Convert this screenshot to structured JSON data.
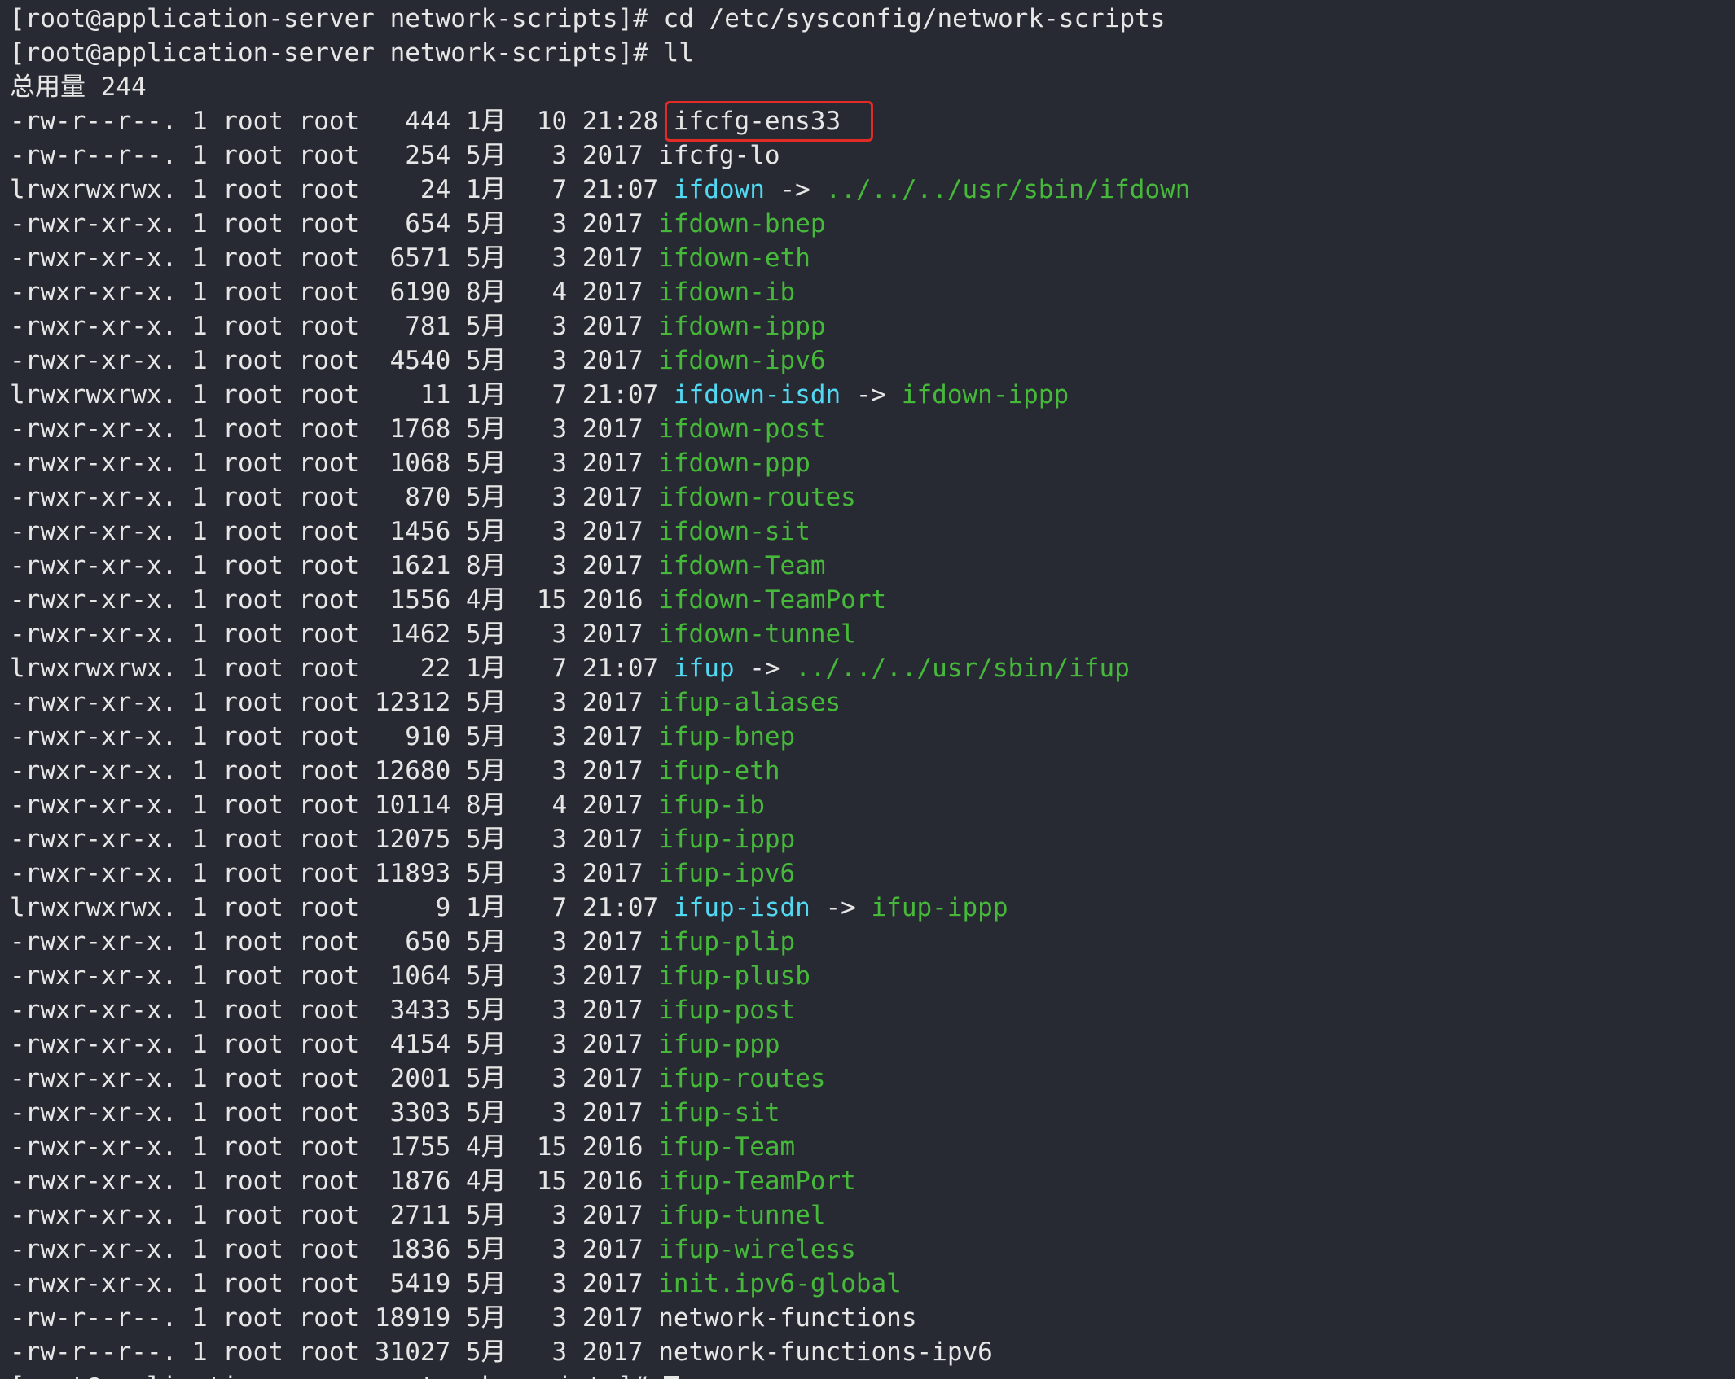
{
  "window": {
    "prompt": "[root@application-server network-scripts]# ",
    "command_cd": "cd /etc/sysconfig/network-scripts",
    "command_ll": "ll",
    "total": "总用量 244",
    "last_prompt_partial": "[root@application-server network-scripts]# ",
    "highlighted_file": "ifcfg-ens33"
  },
  "theme": {
    "background": "#282a33",
    "text": "#e6e6e6",
    "executable": "#46b83a",
    "symlink": "#51d9f2",
    "highlight_box": "#e32b25"
  },
  "listing": [
    {
      "meta": "-rw-r--r--. 1 root root   444 1月  10 21:28 ",
      "name": "ifcfg-ens33",
      "type": "regular",
      "highlight": true
    },
    {
      "meta": "-rw-r--r--. 1 root root   254 5月   3 2017 ",
      "name": "ifcfg-lo",
      "type": "regular"
    },
    {
      "meta": "lrwxrwxrwx. 1 root root    24 1月   7 21:07 ",
      "name": "ifdown",
      "type": "link",
      "target": "../../../usr/sbin/ifdown"
    },
    {
      "meta": "-rwxr-xr-x. 1 root root   654 5月   3 2017 ",
      "name": "ifdown-bnep",
      "type": "exec"
    },
    {
      "meta": "-rwxr-xr-x. 1 root root  6571 5月   3 2017 ",
      "name": "ifdown-eth",
      "type": "exec"
    },
    {
      "meta": "-rwxr-xr-x. 1 root root  6190 8月   4 2017 ",
      "name": "ifdown-ib",
      "type": "exec"
    },
    {
      "meta": "-rwxr-xr-x. 1 root root   781 5月   3 2017 ",
      "name": "ifdown-ippp",
      "type": "exec"
    },
    {
      "meta": "-rwxr-xr-x. 1 root root  4540 5月   3 2017 ",
      "name": "ifdown-ipv6",
      "type": "exec"
    },
    {
      "meta": "lrwxrwxrwx. 1 root root    11 1月   7 21:07 ",
      "name": "ifdown-isdn",
      "type": "link",
      "target": "ifdown-ippp"
    },
    {
      "meta": "-rwxr-xr-x. 1 root root  1768 5月   3 2017 ",
      "name": "ifdown-post",
      "type": "exec"
    },
    {
      "meta": "-rwxr-xr-x. 1 root root  1068 5月   3 2017 ",
      "name": "ifdown-ppp",
      "type": "exec"
    },
    {
      "meta": "-rwxr-xr-x. 1 root root   870 5月   3 2017 ",
      "name": "ifdown-routes",
      "type": "exec"
    },
    {
      "meta": "-rwxr-xr-x. 1 root root  1456 5月   3 2017 ",
      "name": "ifdown-sit",
      "type": "exec"
    },
    {
      "meta": "-rwxr-xr-x. 1 root root  1621 8月   3 2017 ",
      "name": "ifdown-Team",
      "type": "exec"
    },
    {
      "meta": "-rwxr-xr-x. 1 root root  1556 4月  15 2016 ",
      "name": "ifdown-TeamPort",
      "type": "exec"
    },
    {
      "meta": "-rwxr-xr-x. 1 root root  1462 5月   3 2017 ",
      "name": "ifdown-tunnel",
      "type": "exec"
    },
    {
      "meta": "lrwxrwxrwx. 1 root root    22 1月   7 21:07 ",
      "name": "ifup",
      "type": "link",
      "target": "../../../usr/sbin/ifup"
    },
    {
      "meta": "-rwxr-xr-x. 1 root root 12312 5月   3 2017 ",
      "name": "ifup-aliases",
      "type": "exec"
    },
    {
      "meta": "-rwxr-xr-x. 1 root root   910 5月   3 2017 ",
      "name": "ifup-bnep",
      "type": "exec"
    },
    {
      "meta": "-rwxr-xr-x. 1 root root 12680 5月   3 2017 ",
      "name": "ifup-eth",
      "type": "exec"
    },
    {
      "meta": "-rwxr-xr-x. 1 root root 10114 8月   4 2017 ",
      "name": "ifup-ib",
      "type": "exec"
    },
    {
      "meta": "-rwxr-xr-x. 1 root root 12075 5月   3 2017 ",
      "name": "ifup-ippp",
      "type": "exec"
    },
    {
      "meta": "-rwxr-xr-x. 1 root root 11893 5月   3 2017 ",
      "name": "ifup-ipv6",
      "type": "exec"
    },
    {
      "meta": "lrwxrwxrwx. 1 root root     9 1月   7 21:07 ",
      "name": "ifup-isdn",
      "type": "link",
      "target": "ifup-ippp"
    },
    {
      "meta": "-rwxr-xr-x. 1 root root   650 5月   3 2017 ",
      "name": "ifup-plip",
      "type": "exec"
    },
    {
      "meta": "-rwxr-xr-x. 1 root root  1064 5月   3 2017 ",
      "name": "ifup-plusb",
      "type": "exec"
    },
    {
      "meta": "-rwxr-xr-x. 1 root root  3433 5月   3 2017 ",
      "name": "ifup-post",
      "type": "exec"
    },
    {
      "meta": "-rwxr-xr-x. 1 root root  4154 5月   3 2017 ",
      "name": "ifup-ppp",
      "type": "exec"
    },
    {
      "meta": "-rwxr-xr-x. 1 root root  2001 5月   3 2017 ",
      "name": "ifup-routes",
      "type": "exec"
    },
    {
      "meta": "-rwxr-xr-x. 1 root root  3303 5月   3 2017 ",
      "name": "ifup-sit",
      "type": "exec"
    },
    {
      "meta": "-rwxr-xr-x. 1 root root  1755 4月  15 2016 ",
      "name": "ifup-Team",
      "type": "exec"
    },
    {
      "meta": "-rwxr-xr-x. 1 root root  1876 4月  15 2016 ",
      "name": "ifup-TeamPort",
      "type": "exec"
    },
    {
      "meta": "-rwxr-xr-x. 1 root root  2711 5月   3 2017 ",
      "name": "ifup-tunnel",
      "type": "exec"
    },
    {
      "meta": "-rwxr-xr-x. 1 root root  1836 5月   3 2017 ",
      "name": "ifup-wireless",
      "type": "exec"
    },
    {
      "meta": "-rwxr-xr-x. 1 root root  5419 5月   3 2017 ",
      "name": "init.ipv6-global",
      "type": "exec"
    },
    {
      "meta": "-rw-r--r--. 1 root root 18919 5月   3 2017 ",
      "name": "network-functions",
      "type": "regular"
    },
    {
      "meta": "-rw-r--r--. 1 root root 31027 5月   3 2017 ",
      "name": "network-functions-ipv6",
      "type": "regular"
    }
  ],
  "link_arrow": " -> "
}
